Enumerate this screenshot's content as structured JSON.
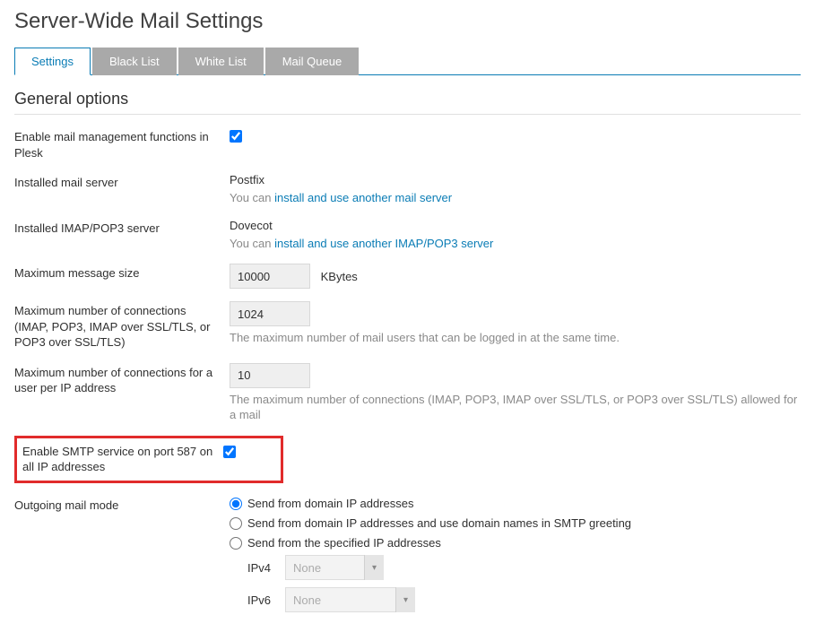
{
  "page_title": "Server-Wide Mail Settings",
  "tabs": {
    "settings": "Settings",
    "blacklist": "Black List",
    "whitelist": "White List",
    "mailqueue": "Mail Queue"
  },
  "section_title": "General options",
  "labels": {
    "enable_mail_mgmt": "Enable mail management functions in Plesk",
    "installed_mail_server": "Installed mail server",
    "installed_imap_pop3": "Installed IMAP/POP3 server",
    "max_msg_size": "Maximum message size",
    "max_msg_size_unit": "KBytes",
    "max_connections": "Maximum number of connections (IMAP, POP3, IMAP over SSL/TLS, or POP3 over SSL/TLS)",
    "max_connections_per_ip": "Maximum number of connections for a user per IP address",
    "enable_smtp_587": "Enable SMTP service on port 587 on all IP addresses",
    "outgoing_mail_mode": "Outgoing mail mode",
    "ipv4": "IPv4",
    "ipv6": "IPv6"
  },
  "values": {
    "mail_server_name": "Postfix",
    "mail_server_hint_prefix": "You can ",
    "mail_server_link": "install and use another mail server",
    "imap_pop3_name": "Dovecot",
    "imap_pop3_hint_prefix": "You can ",
    "imap_pop3_link": "install and use another IMAP/POP3 server",
    "max_msg_size": "10000",
    "max_connections": "1024",
    "max_connections_hint": "The maximum number of mail users that can be logged in at the same time.",
    "max_connections_per_ip": "10",
    "max_connections_per_ip_hint": "The maximum number of connections (IMAP, POP3, IMAP over SSL/TLS, or POP3 over SSL/TLS) allowed for a mail",
    "ipv4_value": "None",
    "ipv6_value": "None"
  },
  "radios": {
    "domain_ip": "Send from domain IP addresses",
    "domain_ip_names": "Send from domain IP addresses and use domain names in SMTP greeting",
    "specified_ip": "Send from the specified IP addresses"
  }
}
